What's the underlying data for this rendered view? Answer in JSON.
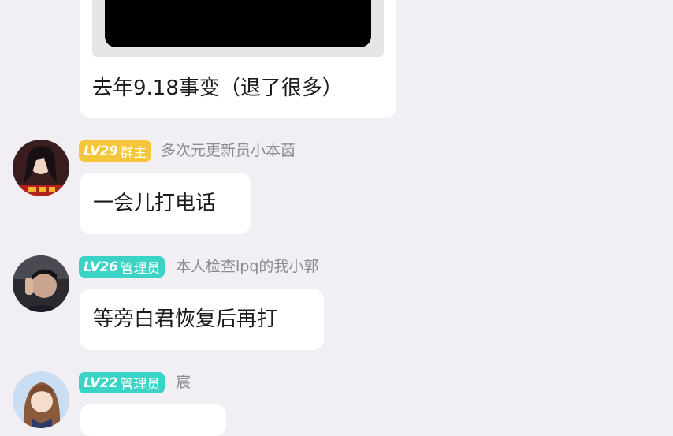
{
  "messages": [
    {
      "type": "image",
      "caption": "去年9.18事变（退了很多）"
    },
    {
      "level": "LV29",
      "role": "群主",
      "role_color": "#f5c53a",
      "nickname": "多次元更新员小本菌",
      "text": "一会儿打电话",
      "avatar_icon": "anime-girl-avatar"
    },
    {
      "level": "LV26",
      "role": "管理员",
      "role_color": "#3ad3c6",
      "nickname": "本人检查lpq的我小郭",
      "text": "等旁白君恢复后再打",
      "avatar_icon": "person-photo-avatar"
    },
    {
      "level": "LV22",
      "role": "管理员",
      "role_color": "#3ad3c6",
      "nickname": "宸",
      "text": "",
      "avatar_icon": "anime-character-avatar"
    }
  ]
}
